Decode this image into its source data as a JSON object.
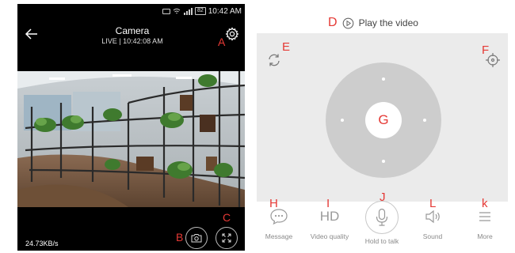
{
  "status_bar": {
    "time": "10:42 AM",
    "battery": "82"
  },
  "camera": {
    "title": "Camera",
    "subtitle": "LIVE | 10:42:08 AM",
    "data_rate": "24.73KB/s"
  },
  "labels": {
    "a": "A",
    "b": "B",
    "c": "C",
    "d": "D",
    "e": "E",
    "f": "F",
    "g": "G",
    "h": "H",
    "i": "I",
    "j": "J",
    "l": "L",
    "k": "k"
  },
  "play_video": {
    "label": "Play the video"
  },
  "toolbar": {
    "message": "Message",
    "hd": "HD",
    "video_quality": "Video quality",
    "hold_to_talk": "Hold to talk",
    "sound": "Sound",
    "more": "More"
  },
  "colors": {
    "annotation": "#e53935",
    "accent": "#e53935",
    "panel_bg": "#ebebeb",
    "joystick": "#cdcdcd"
  }
}
